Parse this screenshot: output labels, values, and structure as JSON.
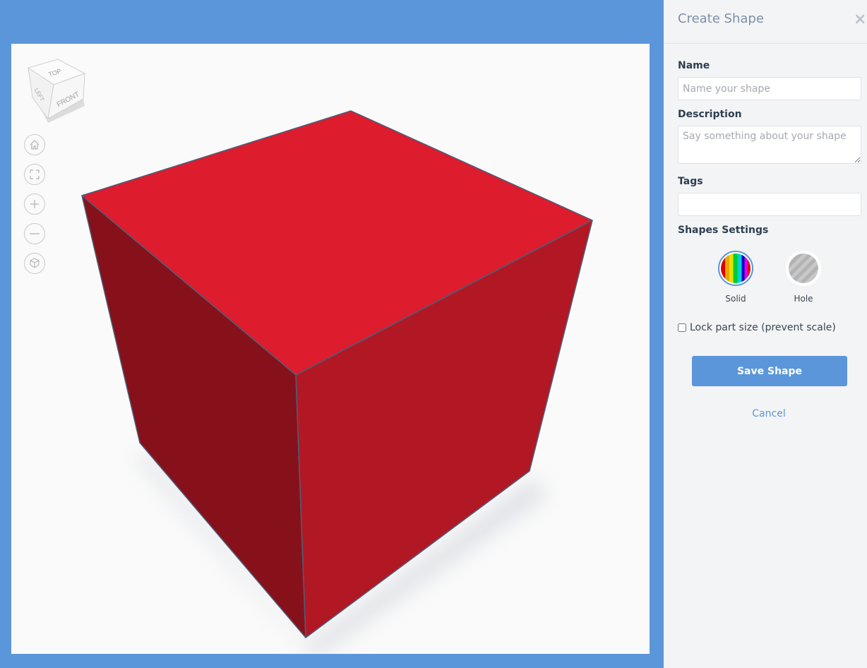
{
  "viewport": {
    "viewcube": {
      "top": "TOP",
      "left": "LEFT",
      "front": "FRONT"
    },
    "nav_buttons": [
      {
        "name": "home",
        "icon": "home-icon"
      },
      {
        "name": "fit-view",
        "icon": "fit-view-icon"
      },
      {
        "name": "zoom-in",
        "icon": "plus-icon"
      },
      {
        "name": "zoom-out",
        "icon": "minus-icon"
      },
      {
        "name": "perspective",
        "icon": "cube-view-icon"
      }
    ],
    "shape": {
      "type": "box",
      "colors": {
        "top": "#dd1c2d",
        "left": "#86111b",
        "right": "#b21823",
        "edge": "#4a5f7a"
      }
    }
  },
  "panel": {
    "title": "Create Shape",
    "close_icon": "×",
    "name_label": "Name",
    "name_placeholder": "Name your shape",
    "name_value": "",
    "description_label": "Description",
    "description_placeholder": "Say something about your shape",
    "description_value": "",
    "tags_label": "Tags",
    "tags_value": "",
    "settings_label": "Shapes Settings",
    "shape_options": [
      {
        "label": "Solid",
        "selected": true
      },
      {
        "label": "Hole",
        "selected": false
      }
    ],
    "lock_label": "Lock part size (prevent scale)",
    "lock_checked": false,
    "save_label": "Save Shape",
    "cancel_label": "Cancel",
    "accent_color": "#5b96da"
  }
}
